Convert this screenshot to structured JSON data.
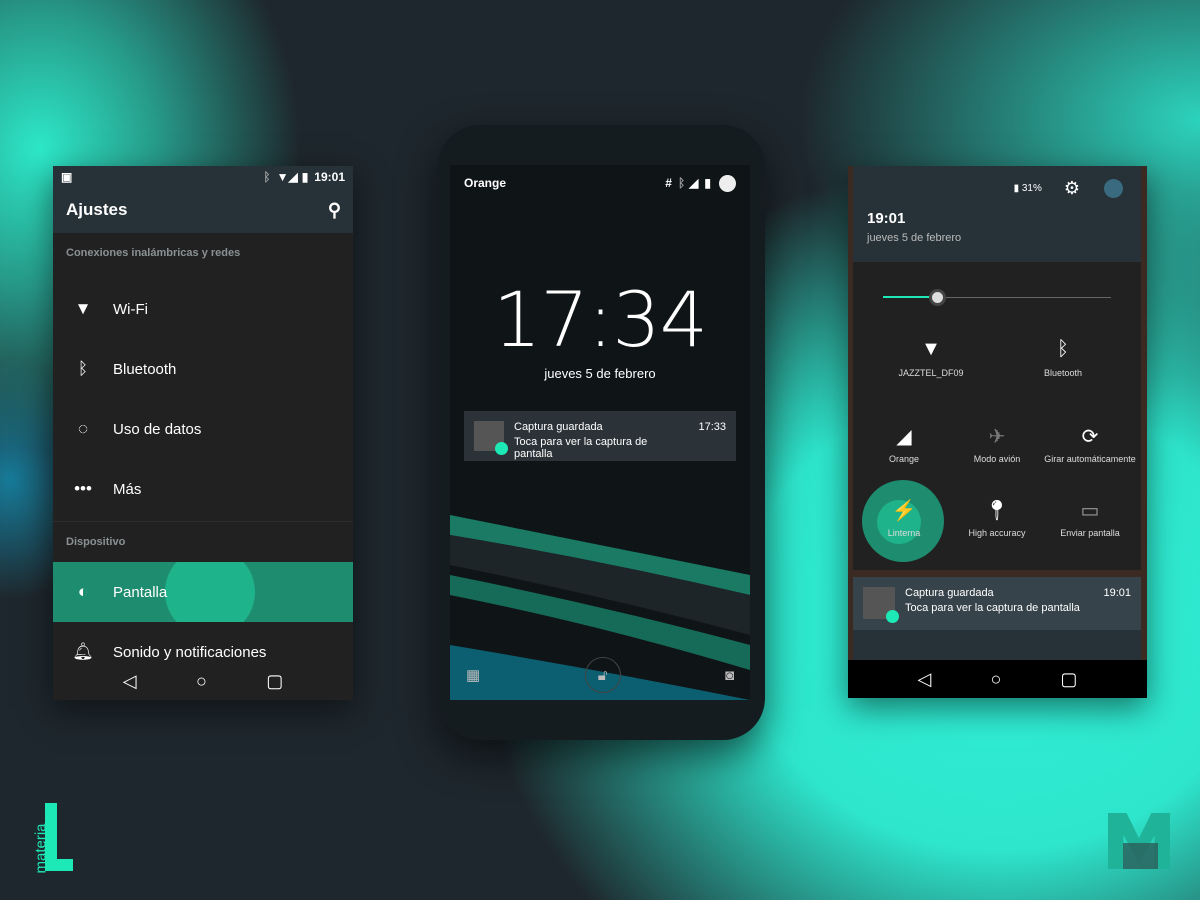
{
  "left": {
    "status_time": "19:01",
    "title": "Ajustes",
    "section1": "Conexiones inalámbricas y redes",
    "items": [
      {
        "label": "Wi-Fi",
        "icon": "wifi-icon"
      },
      {
        "label": "Bluetooth",
        "icon": "bluetooth-icon"
      },
      {
        "label": "Uso de datos",
        "icon": "data-usage-icon"
      },
      {
        "label": "Más",
        "icon": "more-icon"
      }
    ],
    "section2": "Dispositivo",
    "items2": [
      {
        "label": "Pantalla",
        "icon": "brightness-icon"
      },
      {
        "label": "Sonido y notificaciones",
        "icon": "bell-icon"
      }
    ]
  },
  "center": {
    "carrier": "Orange",
    "clock": "17:34",
    "date": "jueves 5 de febrero",
    "notification": {
      "title": "Captura guardada",
      "text": "Toca para ver la captura de pantalla",
      "time": "17:33"
    }
  },
  "right": {
    "battery": "31%",
    "time": "19:01",
    "date": "jueves 5 de febrero",
    "brightness": 0.24,
    "tiles": [
      "JAZZTEL_DF09",
      "Bluetooth",
      "Orange",
      "Modo avión",
      "Girar automáticamente",
      "Linterna",
      "High accuracy",
      "Enviar pantalla"
    ],
    "notification": {
      "title": "Captura guardada",
      "text": "Toca para ver la captura de pantalla",
      "time": "19:01"
    }
  },
  "branding": {
    "left_logo": "materia L",
    "right_logo": "M"
  },
  "colors": {
    "accent": "#1de9b6",
    "highlight": "#1e8c6e",
    "toolbar": "#263238"
  }
}
